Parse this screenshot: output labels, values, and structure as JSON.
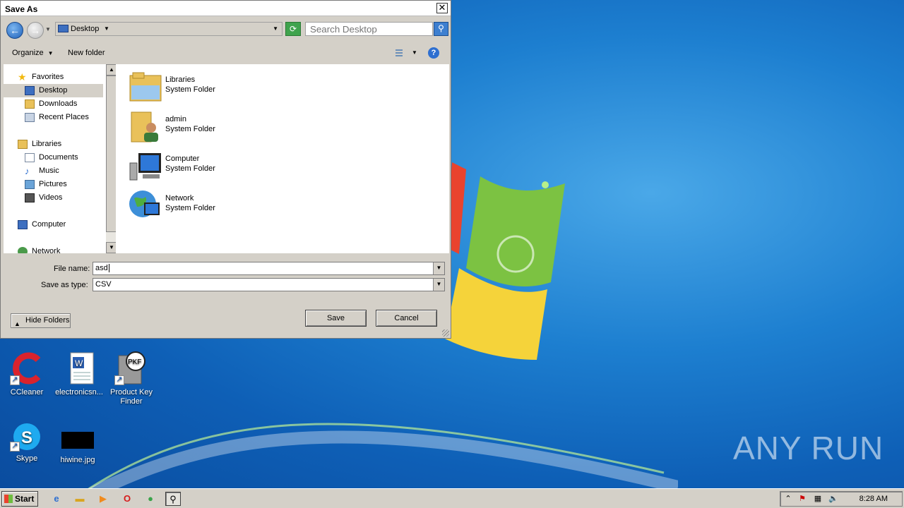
{
  "dialog": {
    "title": "Save As",
    "close_label": "✕",
    "address": {
      "location": "Desktop"
    },
    "search": {
      "placeholder": "Search Desktop"
    },
    "toolbar": {
      "organize": "Organize",
      "new_folder": "New folder",
      "help": "?"
    },
    "nav": {
      "favorites": "Favorites",
      "favorites_items": [
        "Desktop",
        "Downloads",
        "Recent Places"
      ],
      "libraries": "Libraries",
      "libraries_items": [
        "Documents",
        "Music",
        "Pictures",
        "Videos"
      ],
      "computer": "Computer",
      "network": "Network",
      "selected": "Desktop"
    },
    "files": [
      {
        "name": "Libraries",
        "type": "System Folder"
      },
      {
        "name": "admin",
        "type": "System Folder"
      },
      {
        "name": "Computer",
        "type": "System Folder"
      },
      {
        "name": "Network",
        "type": "System Folder"
      }
    ],
    "file_name_label": "File name:",
    "file_name_value": "asd",
    "save_type_label": "Save as type:",
    "save_type_value": "CSV",
    "save_button": "Save",
    "cancel_button": "Cancel",
    "hide_folders": "Hide Folders"
  },
  "desktop": {
    "icons": [
      {
        "label": "CCleaner"
      },
      {
        "label": "electronicsn..."
      },
      {
        "label": "Product Key Finder"
      },
      {
        "label": "Skype"
      },
      {
        "label": "hiwine.jpg"
      }
    ],
    "pkf_text": "PKF",
    "watermark": "ANY RUN"
  },
  "taskbar": {
    "start_label": "Start",
    "clock": "8:28 AM"
  },
  "colors": {
    "desktop_blue": "#1d7fd0",
    "dialog_face": "#d4d0c8",
    "accent": "#2e6fd0"
  }
}
